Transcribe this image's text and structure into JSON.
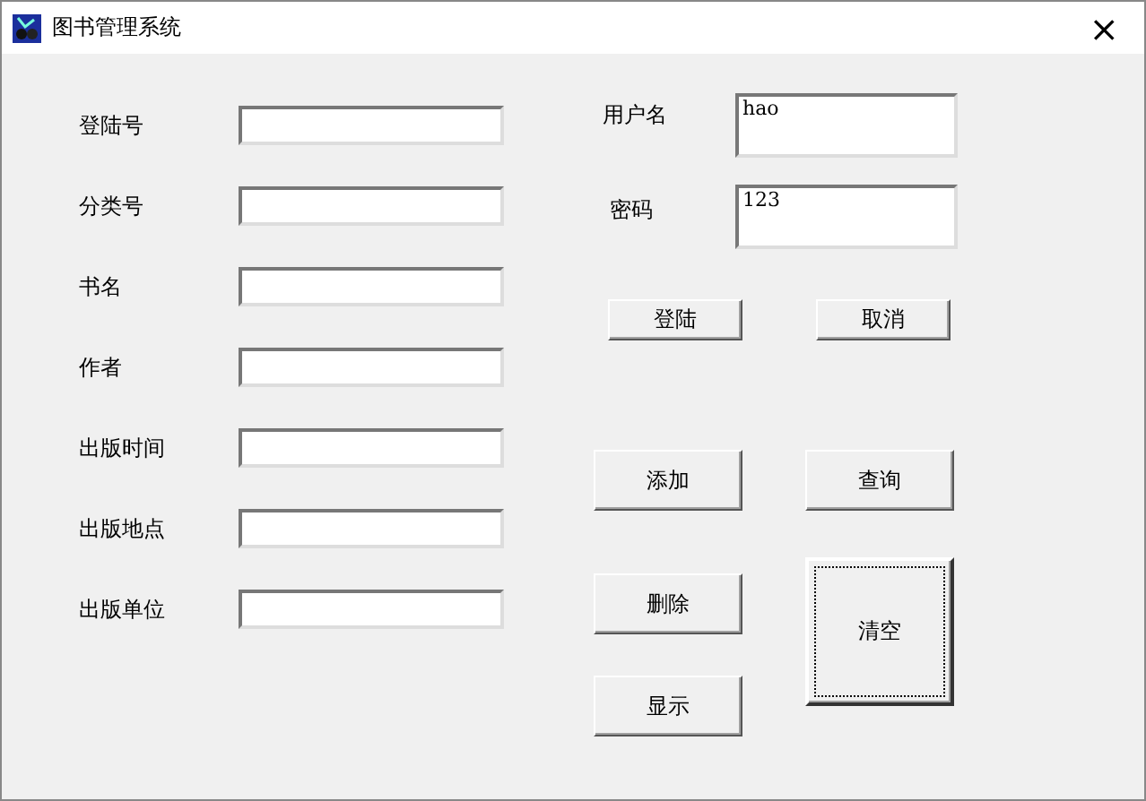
{
  "window": {
    "title": "图书管理系统",
    "close": "×"
  },
  "book_fields": [
    {
      "label": "登陆号"
    },
    {
      "label": "分类号"
    },
    {
      "label": "书名"
    },
    {
      "label": "作者"
    },
    {
      "label": "出版时间"
    },
    {
      "label": "出版地点"
    },
    {
      "label": "出版单位"
    }
  ],
  "login": {
    "fields": [
      {
        "label": "用户名",
        "value": "hao"
      },
      {
        "label": "密码",
        "value": "123"
      }
    ],
    "buttons": [
      {
        "label": "登陆",
        "focused": false
      },
      {
        "label": "取消",
        "focused": false
      }
    ]
  },
  "actions": [
    {
      "label": "添加",
      "focused": false
    },
    {
      "label": "查询",
      "focused": false
    },
    {
      "label": "删除",
      "focused": false
    },
    {
      "label": "清空",
      "focused": true
    },
    {
      "label": "显示",
      "focused": false
    }
  ]
}
